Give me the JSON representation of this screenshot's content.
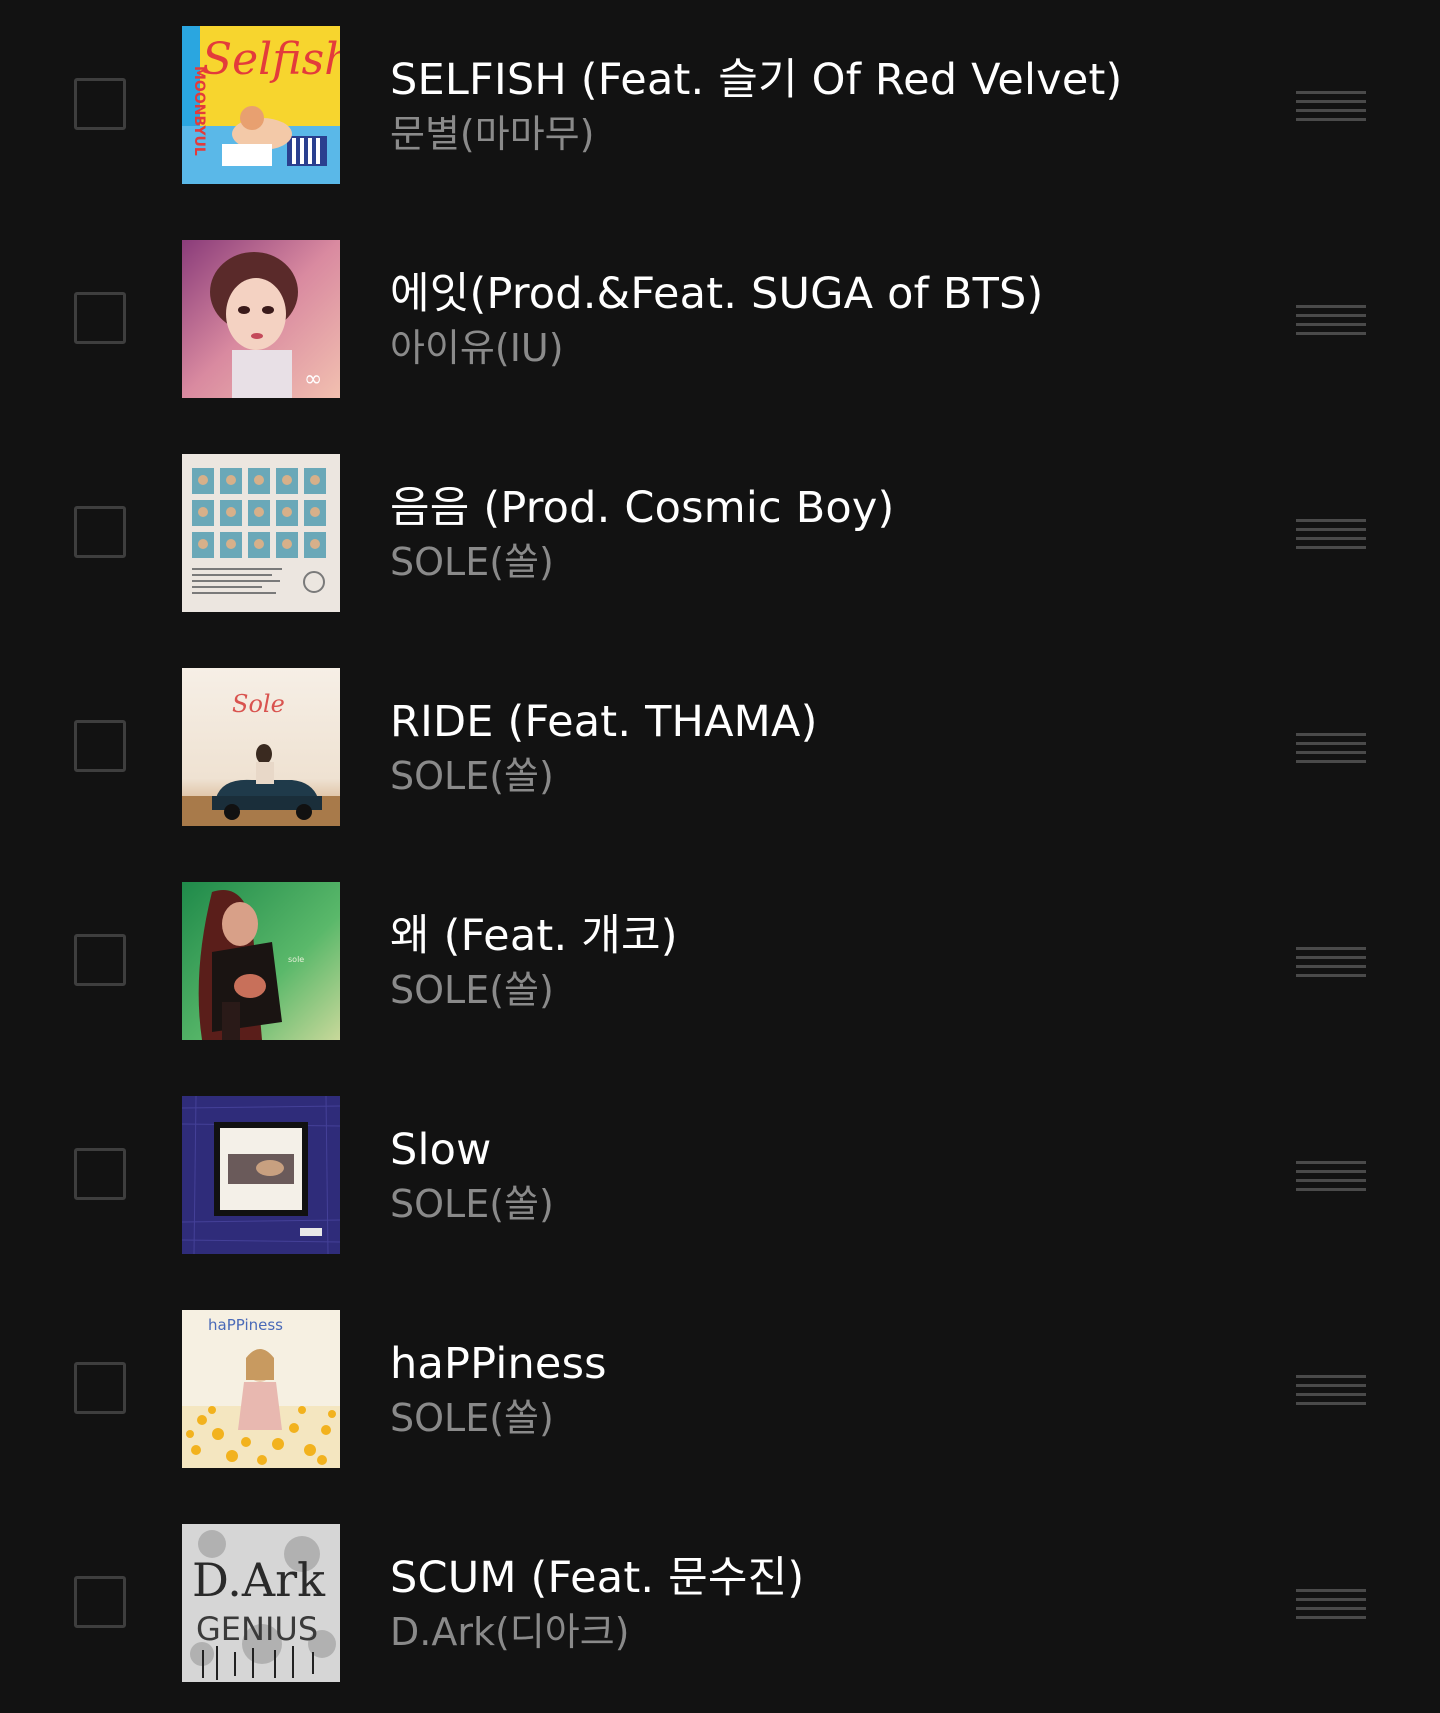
{
  "tracks": [
    {
      "title": "SELFISH (Feat. 슬기 Of Red Velvet)",
      "artist": "문별(마마무)",
      "art_icon": "album-art-selfish",
      "art_text": "Selfish",
      "art_side_text": "MOONBYUL"
    },
    {
      "title": "에잇(Prod.&Feat. SUGA of BTS)",
      "artist": "아이유(IU)",
      "art_icon": "album-art-eight"
    },
    {
      "title": "음음 (Prod. Cosmic Boy)",
      "artist": "SOLE(쏠)",
      "art_icon": "album-art-mmm"
    },
    {
      "title": "RIDE (Feat. THAMA)",
      "artist": "SOLE(쏠)",
      "art_icon": "album-art-ride",
      "art_text": "Sole"
    },
    {
      "title": "왜 (Feat. 개코)",
      "artist": "SOLE(쏠)",
      "art_icon": "album-art-why"
    },
    {
      "title": "Slow",
      "artist": "SOLE(쏠)",
      "art_icon": "album-art-slow"
    },
    {
      "title": "haPPiness",
      "artist": "SOLE(쏠)",
      "art_icon": "album-art-happiness",
      "art_text": "haPPiness"
    },
    {
      "title": "SCUM (Feat. 문수진)",
      "artist": "D.Ark(디아크)",
      "art_icon": "album-art-genius",
      "art_text": "D.Ark",
      "art_sub_text": "GENIUS"
    }
  ],
  "colors": {
    "background": "#121212",
    "title": "#ffffff",
    "artist": "#8a8a8a",
    "checkbox_border": "#3e3e3e",
    "handle": "#4a4a4a"
  }
}
